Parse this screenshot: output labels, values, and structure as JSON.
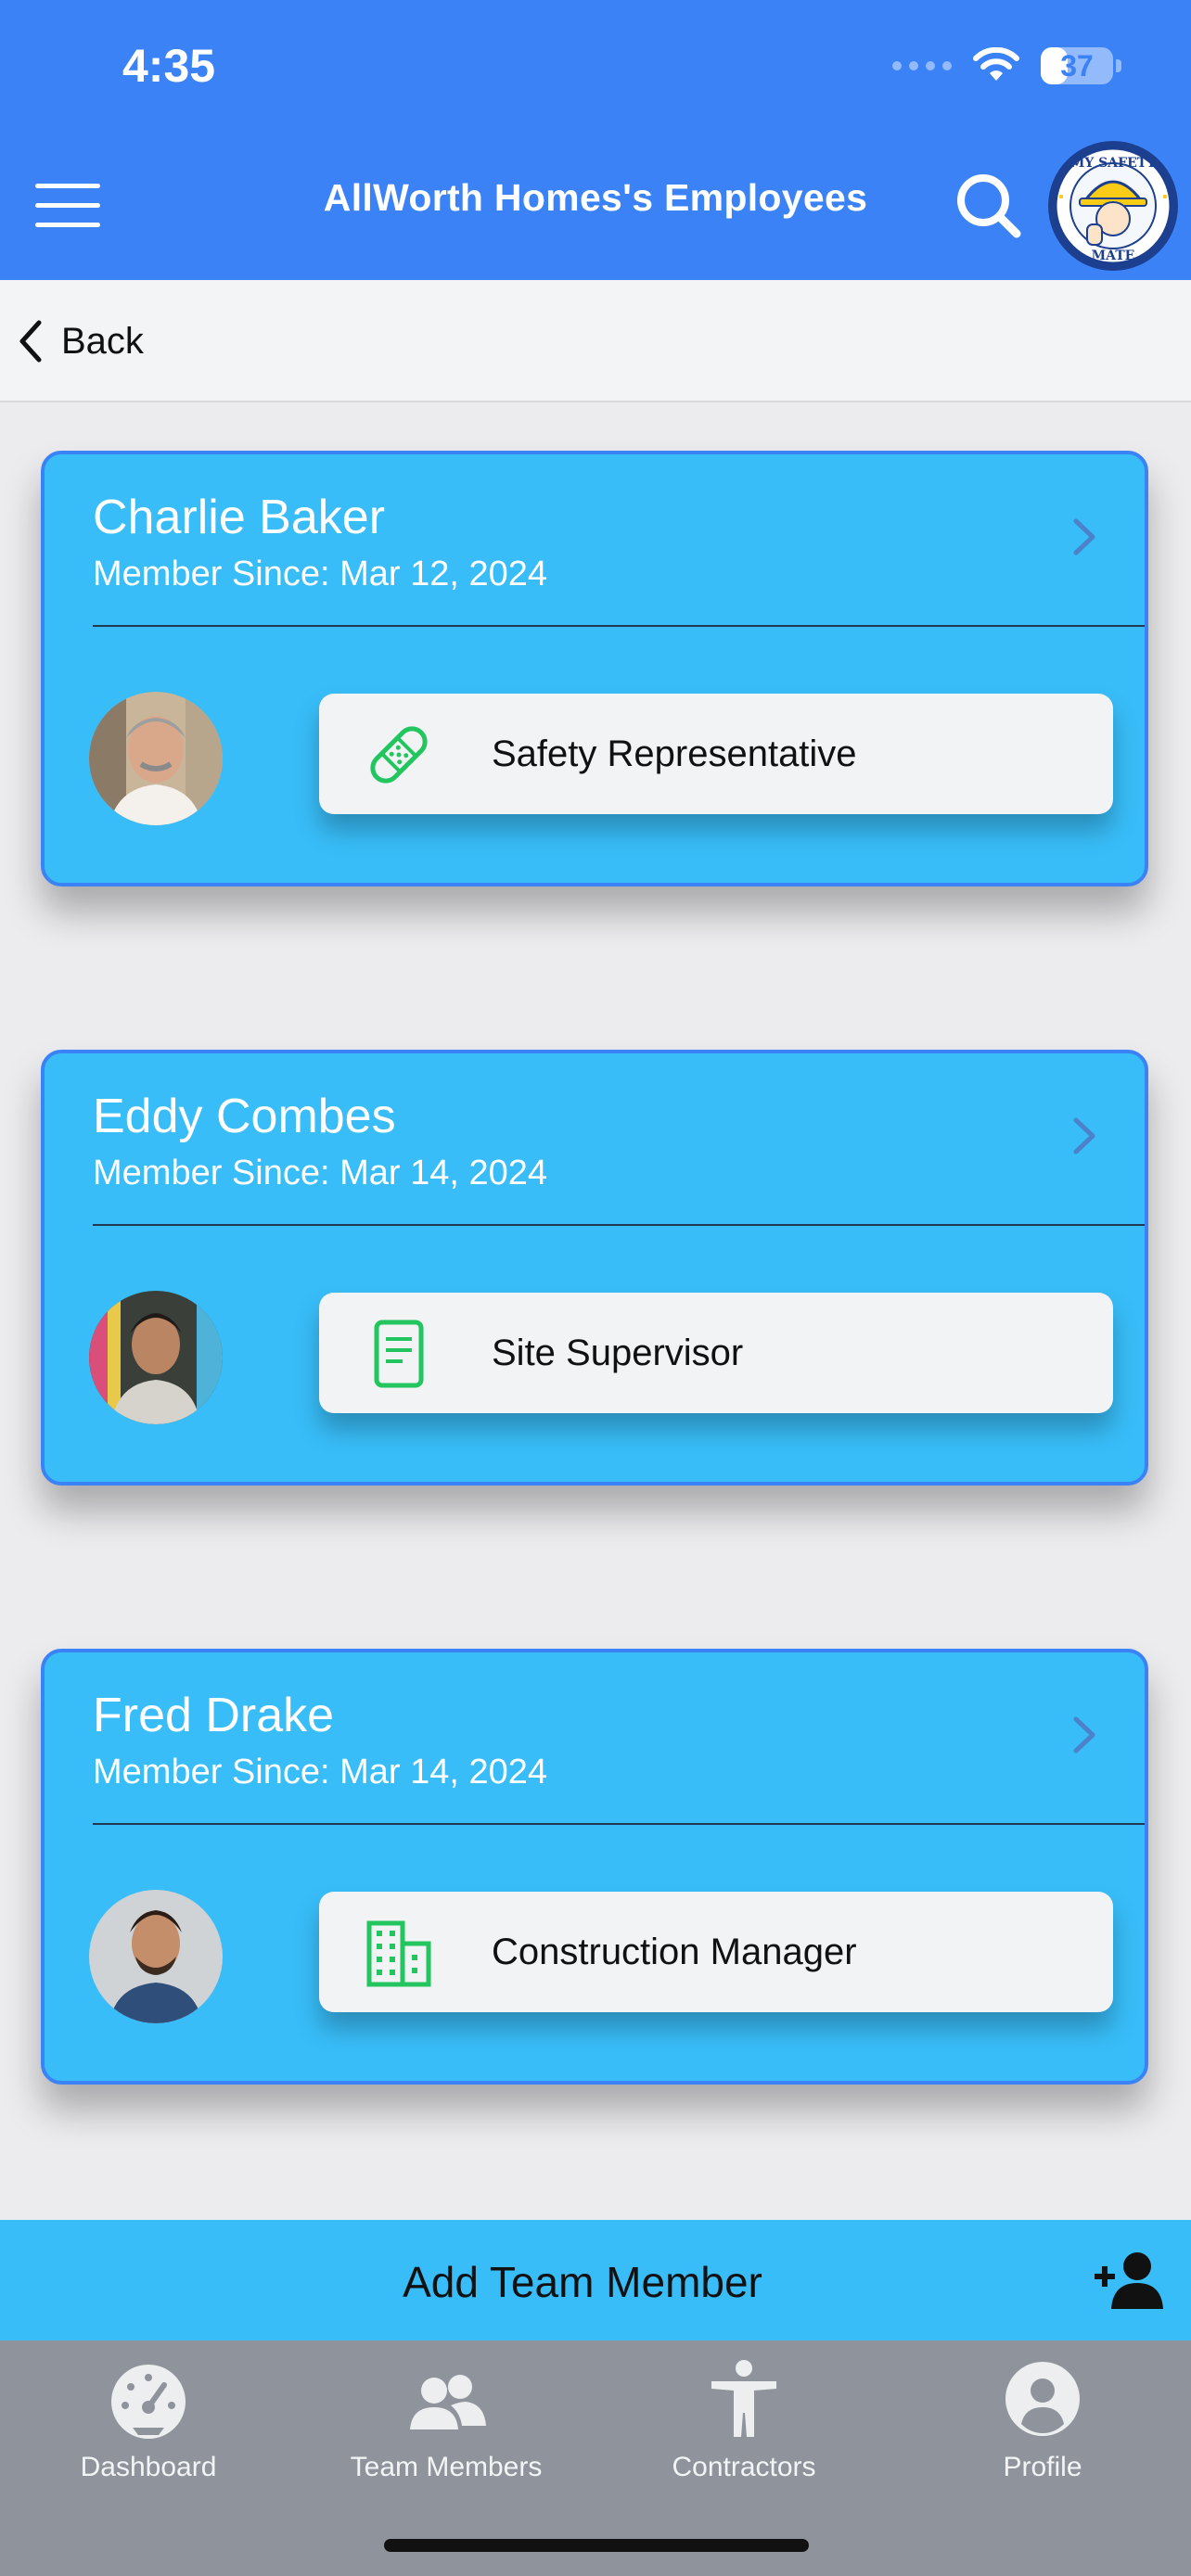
{
  "status_bar": {
    "time": "4:35",
    "battery": "37",
    "battery_level": 0.37
  },
  "header": {
    "title": "AllWorth Homes's Employees",
    "menu_icon": "hamburger-menu-icon",
    "search_icon": "search-icon",
    "logo_icon": "my-safety-mate-logo",
    "logo_text_top": "MY SAFETY",
    "logo_text_bottom": "MATE"
  },
  "back": {
    "label": "Back"
  },
  "employees": [
    {
      "name": "Charlie Baker",
      "member_since": "Member Since: Mar 12, 2024",
      "role": "Safety Representative",
      "role_icon": "bandage-icon"
    },
    {
      "name": "Eddy Combes",
      "member_since": "Member Since: Mar 14, 2024",
      "role": "Site Supervisor",
      "role_icon": "document-icon"
    },
    {
      "name": "Fred Drake",
      "member_since": "Member Since: Mar 14, 2024",
      "role": "Construction Manager",
      "role_icon": "building-icon"
    }
  ],
  "add_member": {
    "label": "Add Team Member",
    "icon": "add-user-icon"
  },
  "tabs": [
    {
      "label": "Dashboard",
      "icon": "gauge-icon"
    },
    {
      "label": "Team Members",
      "icon": "users-icon"
    },
    {
      "label": "Contractors",
      "icon": "person-icon"
    },
    {
      "label": "Profile",
      "icon": "profile-icon"
    }
  ],
  "colors": {
    "header": "#3b82f6",
    "card": "#38bdf8",
    "card_border": "#3b82f6",
    "role_icon": "#22c55e",
    "tabbar": "#8f949c"
  }
}
